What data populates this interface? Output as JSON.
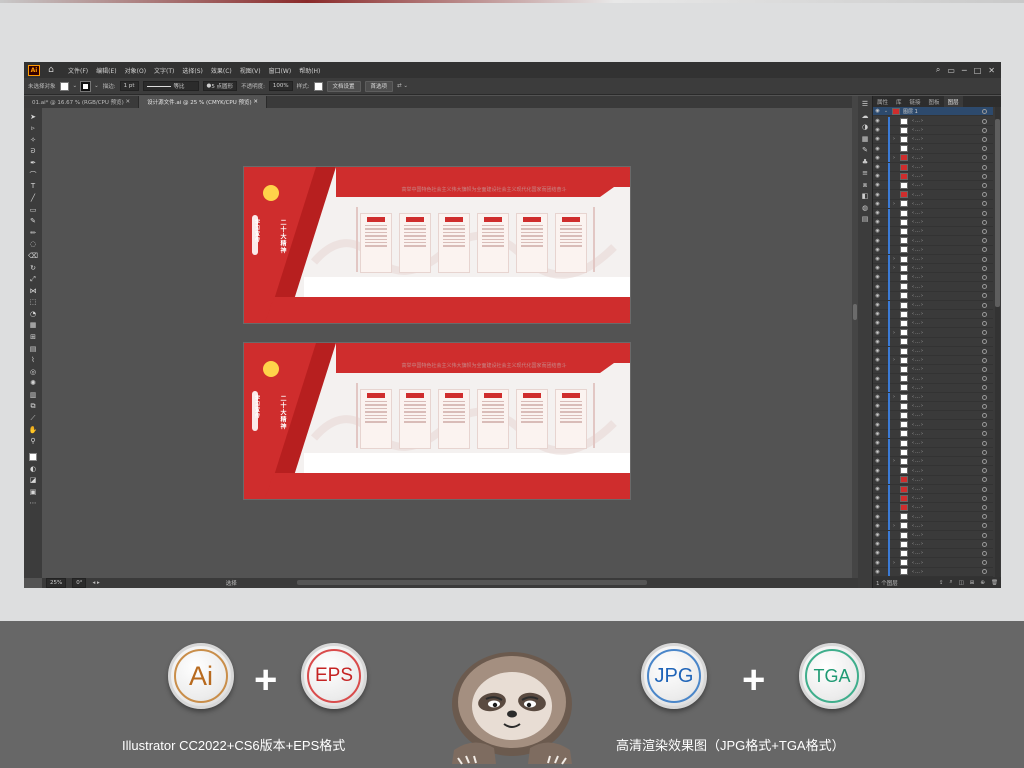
{
  "menubar": {
    "app_logo": "Ai",
    "items": [
      "文件(F)",
      "编辑(E)",
      "对象(O)",
      "文字(T)",
      "选择(S)",
      "效果(C)",
      "视图(V)",
      "窗口(W)",
      "帮助(H)"
    ]
  },
  "controlbar": {
    "selection_label": "未选择对象",
    "stroke_label": "描边:",
    "stroke_value": "1 pt",
    "line_style": "等比",
    "brush": "5 点圆形",
    "opacity_label": "不透明度:",
    "opacity_value": "100%",
    "style_label": "样式:",
    "doc_setup": "文档设置",
    "preferences": "首选项"
  },
  "tabs": [
    {
      "label": "01.ai* @ 16.67 % (RGB/CPU 预览)"
    },
    {
      "label": "设计源文件.ai @ 25 % (CMYK/CPU 预览)"
    }
  ],
  "artboard": {
    "title": "高举中国特色社会主义伟大旗帜为全面建设社会主义现代化国家而团结奋斗",
    "vertical_main": "二十大精神",
    "vertical_sub": "学习宣传"
  },
  "statusbar": {
    "zoom": "25%",
    "rotation": "0°",
    "tool": "选择"
  },
  "layers_panel": {
    "tabs": [
      "属性",
      "库",
      "链接",
      "图板",
      "图层"
    ],
    "top_layer": "图层 1",
    "footer": "1 个图层"
  },
  "colors": {
    "red": "#cf2d2d",
    "ui_dark": "#323232",
    "ui_mid": "#3c3c3c",
    "canvas": "#535353",
    "promo_bg": "#676767"
  },
  "promo": {
    "ai_badge": "Ai",
    "eps_badge": "EPS",
    "jpg_badge": "JPG",
    "tga_badge": "TGA",
    "plus": "+",
    "caption_left": "Illustrator CC2022+CS6版本+EPS格式",
    "caption_right": "高清渲染效果图（JPG格式+TGA格式）"
  }
}
